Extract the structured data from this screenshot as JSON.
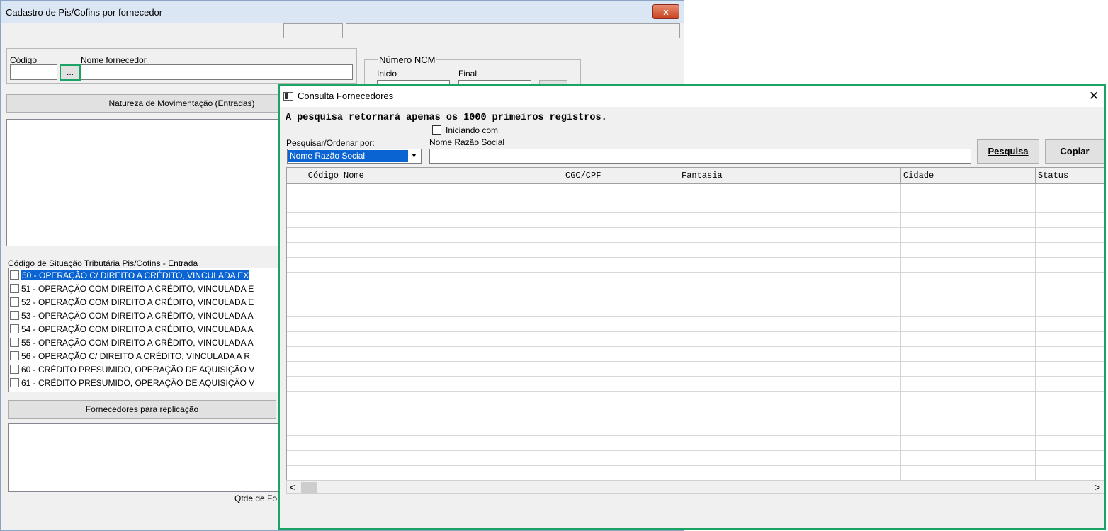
{
  "main_window": {
    "title": "Cadastro de Pis/Cofins por fornecedor",
    "close_glyph": "x",
    "codigo_label": "Código",
    "nome_fornecedor_label": "Nome fornecedor",
    "lookup_button": "...",
    "ncm_group_label": "Número NCM",
    "inicio_label": "Inicio",
    "final_label": "Final",
    "natureza_button": "Natureza de Movimentação (Entradas)",
    "cst_label": "Código de Situação Tributária Pis/Cofins - Entrada",
    "cst_items": [
      "50 - OPERAÇÃO C/ DIREITO A CRÉDITO, VINCULADA EX",
      "51 - OPERAÇÃO COM DIREITO A CRÉDITO, VINCULADA E",
      "52 - OPERAÇÃO COM DIREITO A CRÉDITO, VINCULADA E",
      "53 - OPERAÇÃO COM DIREITO A CRÉDITO, VINCULADA A",
      "54 - OPERAÇÃO COM DIREITO A CRÉDITO, VINCULADA A",
      "55 - OPERAÇÃO COM DIREITO A CRÉDITO, VINCULADA A",
      "56 - OPERAÇÃO C/ DIREITO A CRÉDITO, VINCULADA A R",
      "60 - CRÉDITO PRESUMIDO, OPERAÇÃO DE AQUISIÇÃO V",
      "61 - CRÉDITO PRESUMIDO, OPERAÇÃO DE AQUISIÇÃO V"
    ],
    "fornecedores_button": "Fornecedores para replicação",
    "qtde_label": "Qtde de Fo"
  },
  "dialog": {
    "title": "Consulta Fornecedores",
    "close_glyph": "✕",
    "notice": "A pesquisa retornará apenas os 1000 primeiros registros.",
    "iniciando_label": "Iniciando com",
    "ordenar_label": "Pesquisar/Ordenar por:",
    "ordenar_selected": "Nome Razão Social",
    "search_label": "Nome Razão Social",
    "search_value": "",
    "pesquisa_button": "Pesquisa",
    "copiar_button": "Copiar",
    "columns": [
      "Código",
      "Nome",
      "CGC/CPF",
      "Fantasia",
      "Cidade",
      "Status"
    ],
    "scroll_left": "<",
    "scroll_right": ">"
  },
  "colors": {
    "highlight_border": "#1aa363",
    "selection": "#0a64d2"
  }
}
